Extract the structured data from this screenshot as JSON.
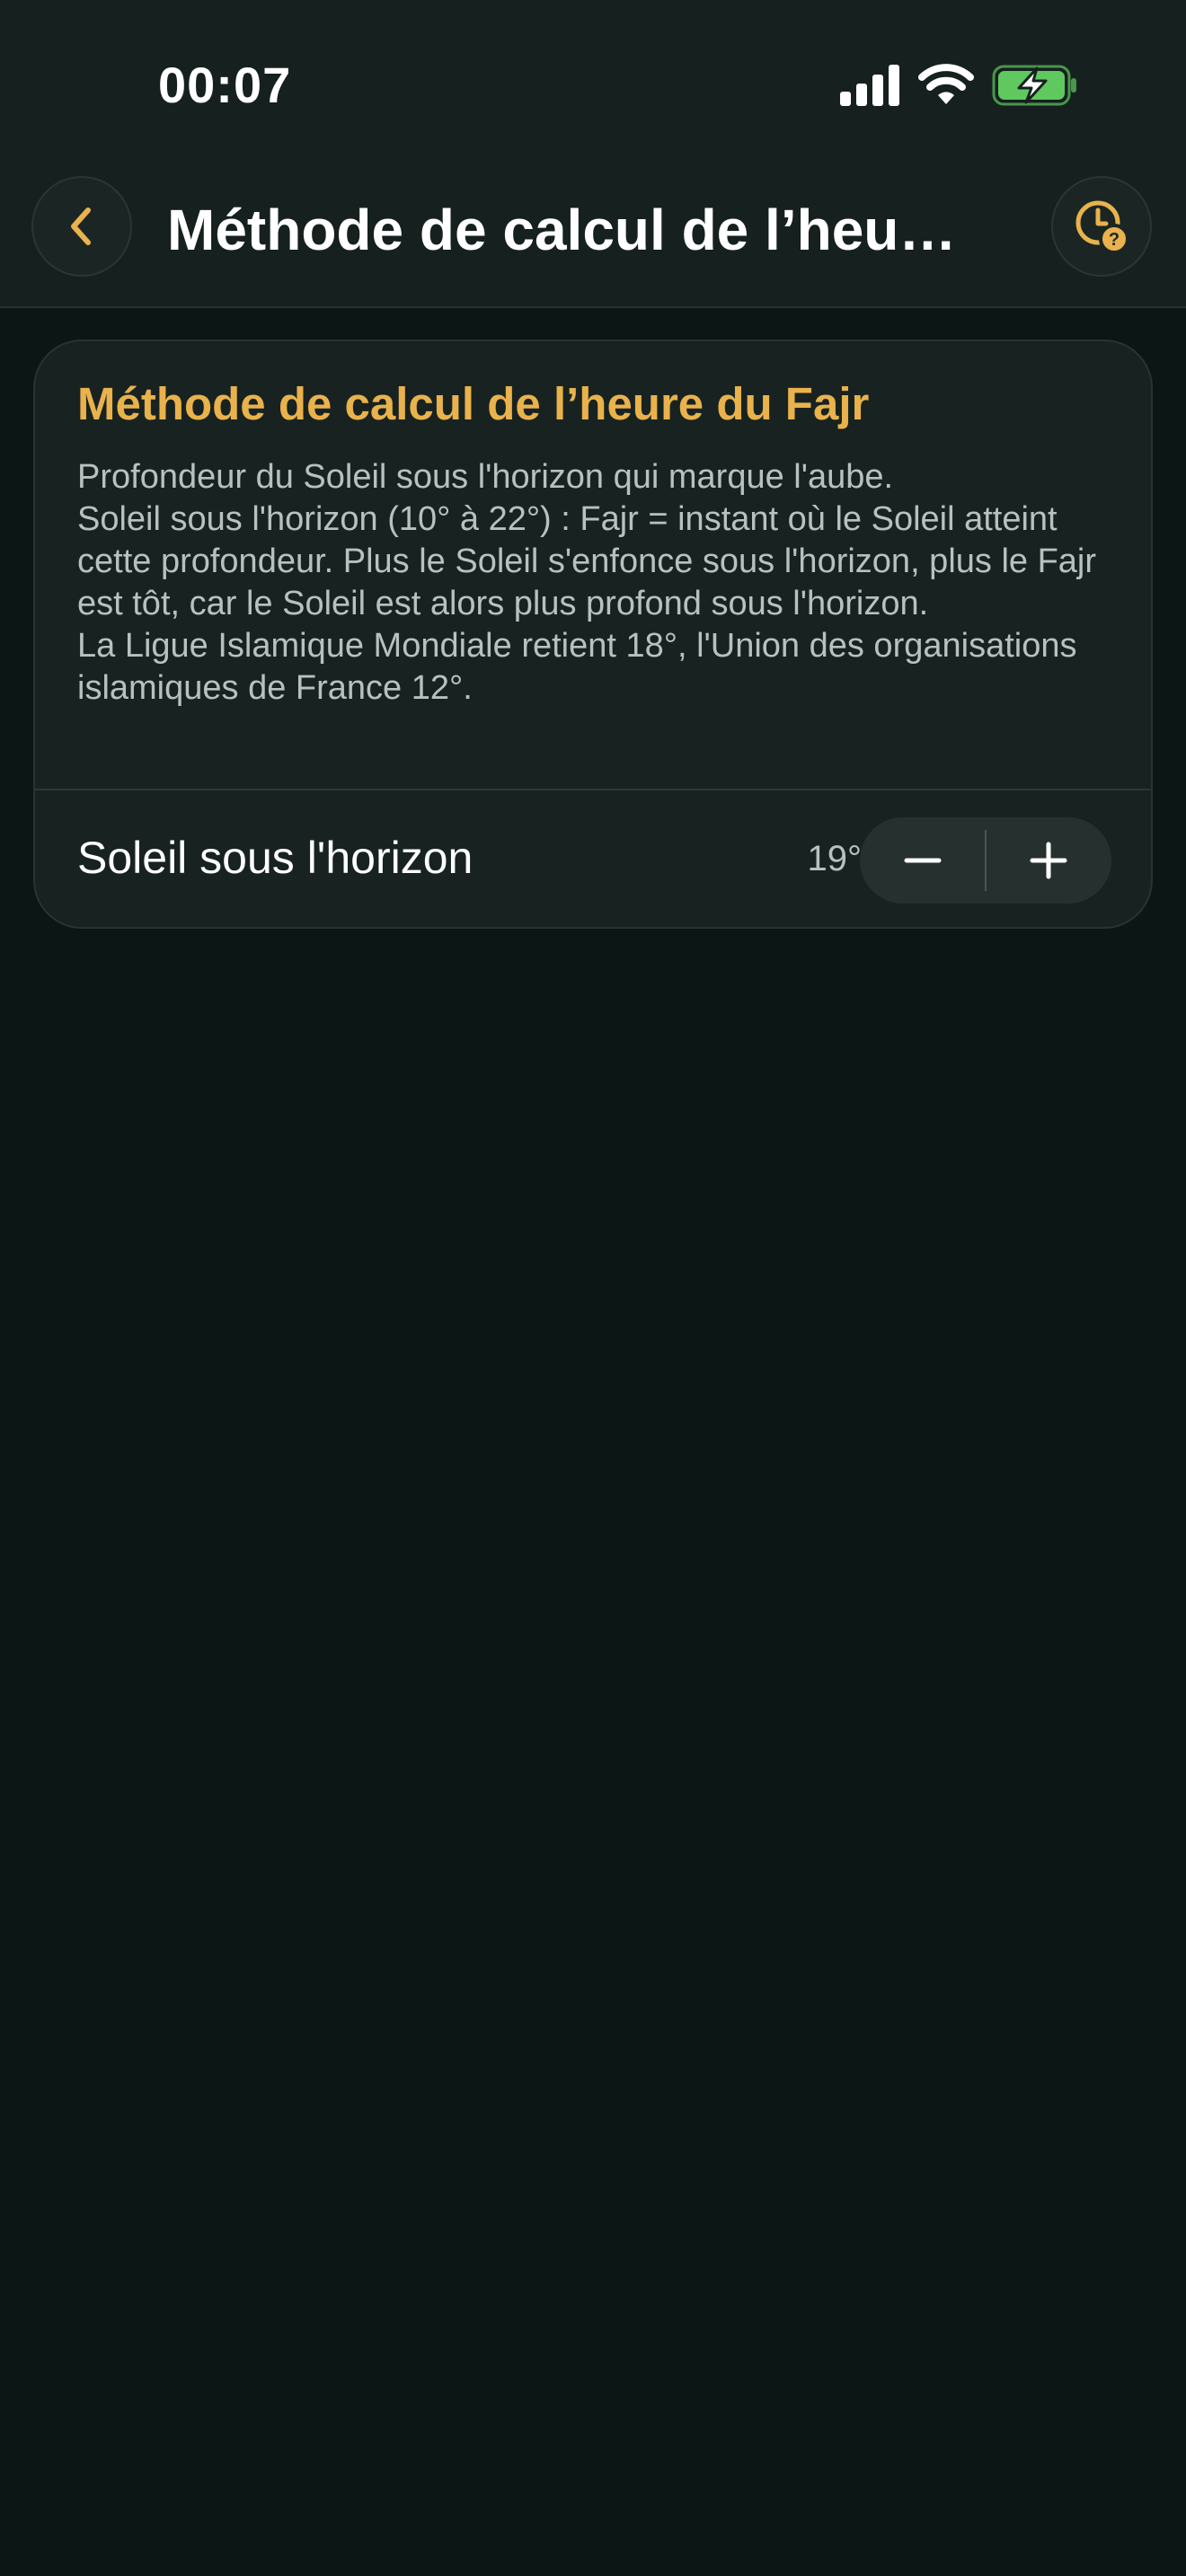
{
  "status_bar": {
    "time": "00:07"
  },
  "nav": {
    "title": "Méthode de calcul de l’heure du Fajr",
    "back_icon": "chevron-left",
    "help_icon": "clock-question"
  },
  "card": {
    "title": "Méthode de calcul de l’heure du Fajr",
    "description": "Profondeur du Soleil sous l'horizon qui marque l'aube.\nSoleil sous l'horizon (10° à 22°) : Fajr = instant où le Soleil atteint cette profondeur. Plus le Soleil s'enfonce sous l'horizon, plus le Fajr est tôt, car le Soleil est alors plus profond sous l'horizon.\nLa Ligue Islamique Mondiale retient 18°, l'Union des organisations islamiques de France 12°."
  },
  "setting": {
    "label": "Soleil sous l'horizon",
    "value": "19°",
    "minus_icon": "minus",
    "plus_icon": "plus"
  },
  "colors": {
    "accent": "#E9B24C",
    "background": "#0C1614",
    "header_background": "#16211F",
    "card_background": "#182321",
    "battery_charging": "#5FC95F"
  }
}
